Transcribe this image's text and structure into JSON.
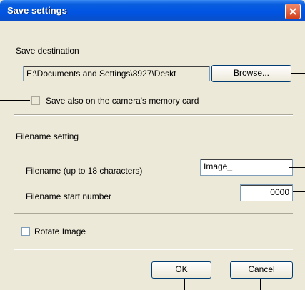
{
  "window": {
    "title": "Save settings"
  },
  "destination": {
    "heading": "Save destination",
    "path_value": "E:\\Documents and Settings\\8927\\Deskt",
    "browse_label": "Browse...",
    "save_also_label": "Save also on the camera's memory card"
  },
  "filename_setting": {
    "heading": "Filename setting",
    "filename_label": "Filename (up to 18 characters)",
    "filename_value": "Image_",
    "start_number_label": "Filename start number",
    "start_number_value": "0000"
  },
  "rotate": {
    "label": "Rotate Image"
  },
  "buttons": {
    "ok": "OK",
    "cancel": "Cancel"
  }
}
